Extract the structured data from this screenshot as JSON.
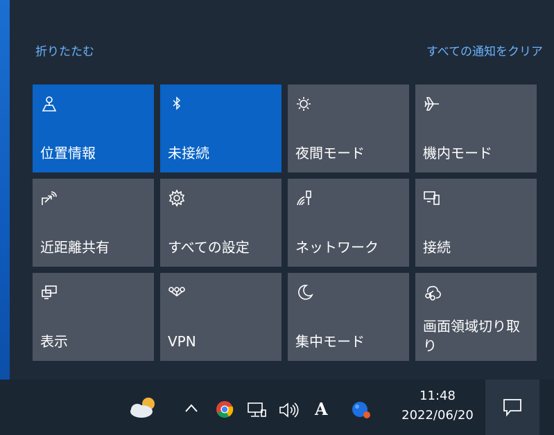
{
  "action_center": {
    "collapse_label": "折りたたむ",
    "clear_all_label": "すべての通知をクリア",
    "tiles": [
      {
        "label": "位置情報",
        "icon": "location-icon",
        "active": true
      },
      {
        "label": "未接続",
        "icon": "bluetooth-icon",
        "active": true
      },
      {
        "label": "夜間モード",
        "icon": "night-light-icon",
        "active": false
      },
      {
        "label": "機内モード",
        "icon": "airplane-icon",
        "active": false
      },
      {
        "label": "近距離共有",
        "icon": "nearby-share-icon",
        "active": false
      },
      {
        "label": "すべての設定",
        "icon": "gear-icon",
        "active": false
      },
      {
        "label": "ネットワーク",
        "icon": "network-icon",
        "active": false
      },
      {
        "label": "接続",
        "icon": "connect-icon",
        "active": false
      },
      {
        "label": "表示",
        "icon": "project-icon",
        "active": false
      },
      {
        "label": "VPN",
        "icon": "vpn-icon",
        "active": false
      },
      {
        "label": "集中モード",
        "icon": "moon-icon",
        "active": false
      },
      {
        "label": "画面領域切り取り",
        "icon": "snip-icon",
        "active": false
      }
    ],
    "colors": {
      "active_tile": "#0a63c5",
      "inactive_tile": "#4c5461",
      "link": "#6ab3ff"
    }
  },
  "taskbar": {
    "time": "11:48",
    "date": "2022/06/20",
    "icons": [
      "weather-icon",
      "chevron-up-icon",
      "chrome-icon",
      "network-status-icon",
      "volume-icon",
      "ime-icon",
      "app-icon",
      "notification-icon"
    ],
    "ime_label": "A"
  }
}
